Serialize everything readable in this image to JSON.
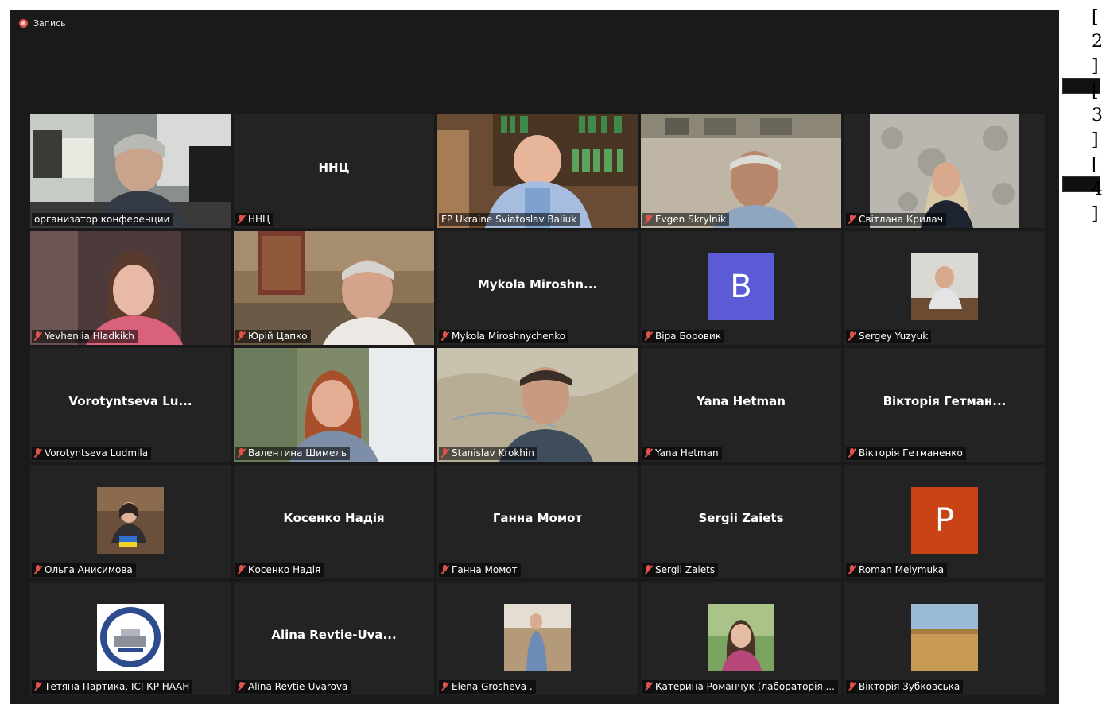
{
  "recording": {
    "label": "Запись"
  },
  "tiles": [
    {
      "name": "организатор конференции"
    },
    {
      "name": "ННЦ",
      "display": "ННЦ"
    },
    {
      "name": "FP Ukraine Sviatoslav Baliuk"
    },
    {
      "name": "Evgen Skrylnik"
    },
    {
      "name": "Світлана Крилач"
    },
    {
      "name": "Yevheniia Hladkikh"
    },
    {
      "name": "Юрій Цапко"
    },
    {
      "name": "Mykola Miroshnychenko",
      "display": "Mykola  Miroshn..."
    },
    {
      "name": "Віра Боровик",
      "initial": "B",
      "color": "#5b5bd6"
    },
    {
      "name": "Sergey Yuzyuk"
    },
    {
      "name": "Vorotyntseva Ludmila",
      "display": "Vorotyntseva  Lu..."
    },
    {
      "name": "Валентина Шимель"
    },
    {
      "name": "Stanislav Krokhin"
    },
    {
      "name": "Yana Hetman",
      "display": "Yana Hetman"
    },
    {
      "name": "Вікторія Гетманенко",
      "display": "Вікторія  Гетман..."
    },
    {
      "name": "Ольга Анисимова"
    },
    {
      "name": "Косенко Надія",
      "display": "Косенко Надія"
    },
    {
      "name": "Ганна Момот",
      "display": "Ганна Момот"
    },
    {
      "name": "Sergii Zaiets",
      "display": "Sergii Zaiets"
    },
    {
      "name": "Roman Melymuka",
      "initial": "P",
      "color": "#c84316"
    },
    {
      "name": "Тетяна Партика, ІСГКР НААН"
    },
    {
      "name": "Alina Revtie-Uvarova",
      "display": "Alina  Revtie-Uva..."
    },
    {
      "name": "Elena Grosheva ."
    },
    {
      "name": "Катерина Романчук (лабораторія ..."
    },
    {
      "name": "Вікторія Зубковська"
    }
  ],
  "side_pages": [
    "[",
    "2",
    "]",
    "[",
    "3",
    "]",
    "[",
    "4",
    "]"
  ],
  "colors": {
    "active_border": "#c3d62f",
    "muted_mic": "#e0524a",
    "background": "#1a1a1a",
    "tile": "#232323"
  }
}
